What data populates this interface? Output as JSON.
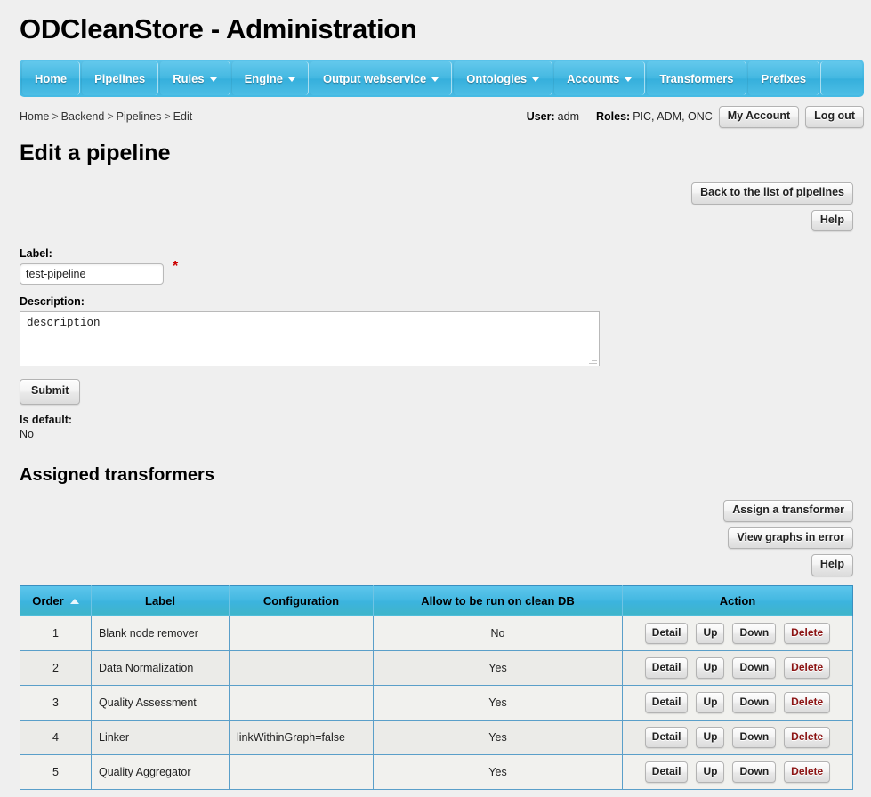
{
  "app": {
    "title": "ODCleanStore - Administration"
  },
  "nav": {
    "items": [
      {
        "label": "Home",
        "has_dropdown": false
      },
      {
        "label": "Pipelines",
        "has_dropdown": false
      },
      {
        "label": "Rules",
        "has_dropdown": true
      },
      {
        "label": "Engine",
        "has_dropdown": true
      },
      {
        "label": "Output webservice",
        "has_dropdown": true
      },
      {
        "label": "Ontologies",
        "has_dropdown": true
      },
      {
        "label": "Accounts",
        "has_dropdown": true
      },
      {
        "label": "Transformers",
        "has_dropdown": false
      },
      {
        "label": "Prefixes",
        "has_dropdown": false
      }
    ]
  },
  "breadcrumb": {
    "items": [
      "Home",
      "Backend",
      "Pipelines",
      "Edit"
    ],
    "separator": ">"
  },
  "user_bar": {
    "user_label": "User:",
    "user_value": "adm",
    "roles_label": "Roles:",
    "roles_value": "PIC, ADM, ONC",
    "my_account_label": "My Account",
    "logout_label": "Log out"
  },
  "page": {
    "title": "Edit a pipeline",
    "back_button": "Back to the list of pipelines",
    "help_button": "Help"
  },
  "form": {
    "label_label": "Label:",
    "label_value": "test-pipeline",
    "required_marker": "*",
    "description_label": "Description:",
    "description_value": "description",
    "submit_label": "Submit",
    "is_default_label": "Is default:",
    "is_default_value": "No"
  },
  "transformers_section": {
    "title": "Assigned transformers",
    "assign_button": "Assign a transformer",
    "view_graphs_button": "View graphs in error",
    "help_button": "Help"
  },
  "table": {
    "columns": [
      {
        "key": "order",
        "label": "Order",
        "sorted": "asc"
      },
      {
        "key": "label",
        "label": "Label",
        "sorted": null
      },
      {
        "key": "configuration",
        "label": "Configuration",
        "sorted": null
      },
      {
        "key": "allow_clean_db",
        "label": "Allow to be run on clean DB",
        "sorted": null
      },
      {
        "key": "action",
        "label": "Action",
        "sorted": null
      }
    ],
    "row_actions": [
      "Detail",
      "Up",
      "Down",
      "Delete"
    ],
    "rows": [
      {
        "order": "1",
        "label": "Blank node remover",
        "configuration": "",
        "allow_clean_db": "No"
      },
      {
        "order": "2",
        "label": "Data Normalization",
        "configuration": "",
        "allow_clean_db": "Yes"
      },
      {
        "order": "3",
        "label": "Quality Assessment",
        "configuration": "",
        "allow_clean_db": "Yes"
      },
      {
        "order": "4",
        "label": "Linker",
        "configuration": "linkWithinGraph=false",
        "allow_clean_db": "Yes"
      },
      {
        "order": "5",
        "label": "Quality Aggregator",
        "configuration": "",
        "allow_clean_db": "Yes"
      }
    ]
  },
  "colors": {
    "page_background": "#efefef",
    "nav_blue": "#41b6e0",
    "table_header_blue": "#46b9e2",
    "table_border_blue": "#5a9fc9",
    "required_red": "#cc0000",
    "delete_red": "#8c1414",
    "row_background": "#f1f1ee"
  }
}
